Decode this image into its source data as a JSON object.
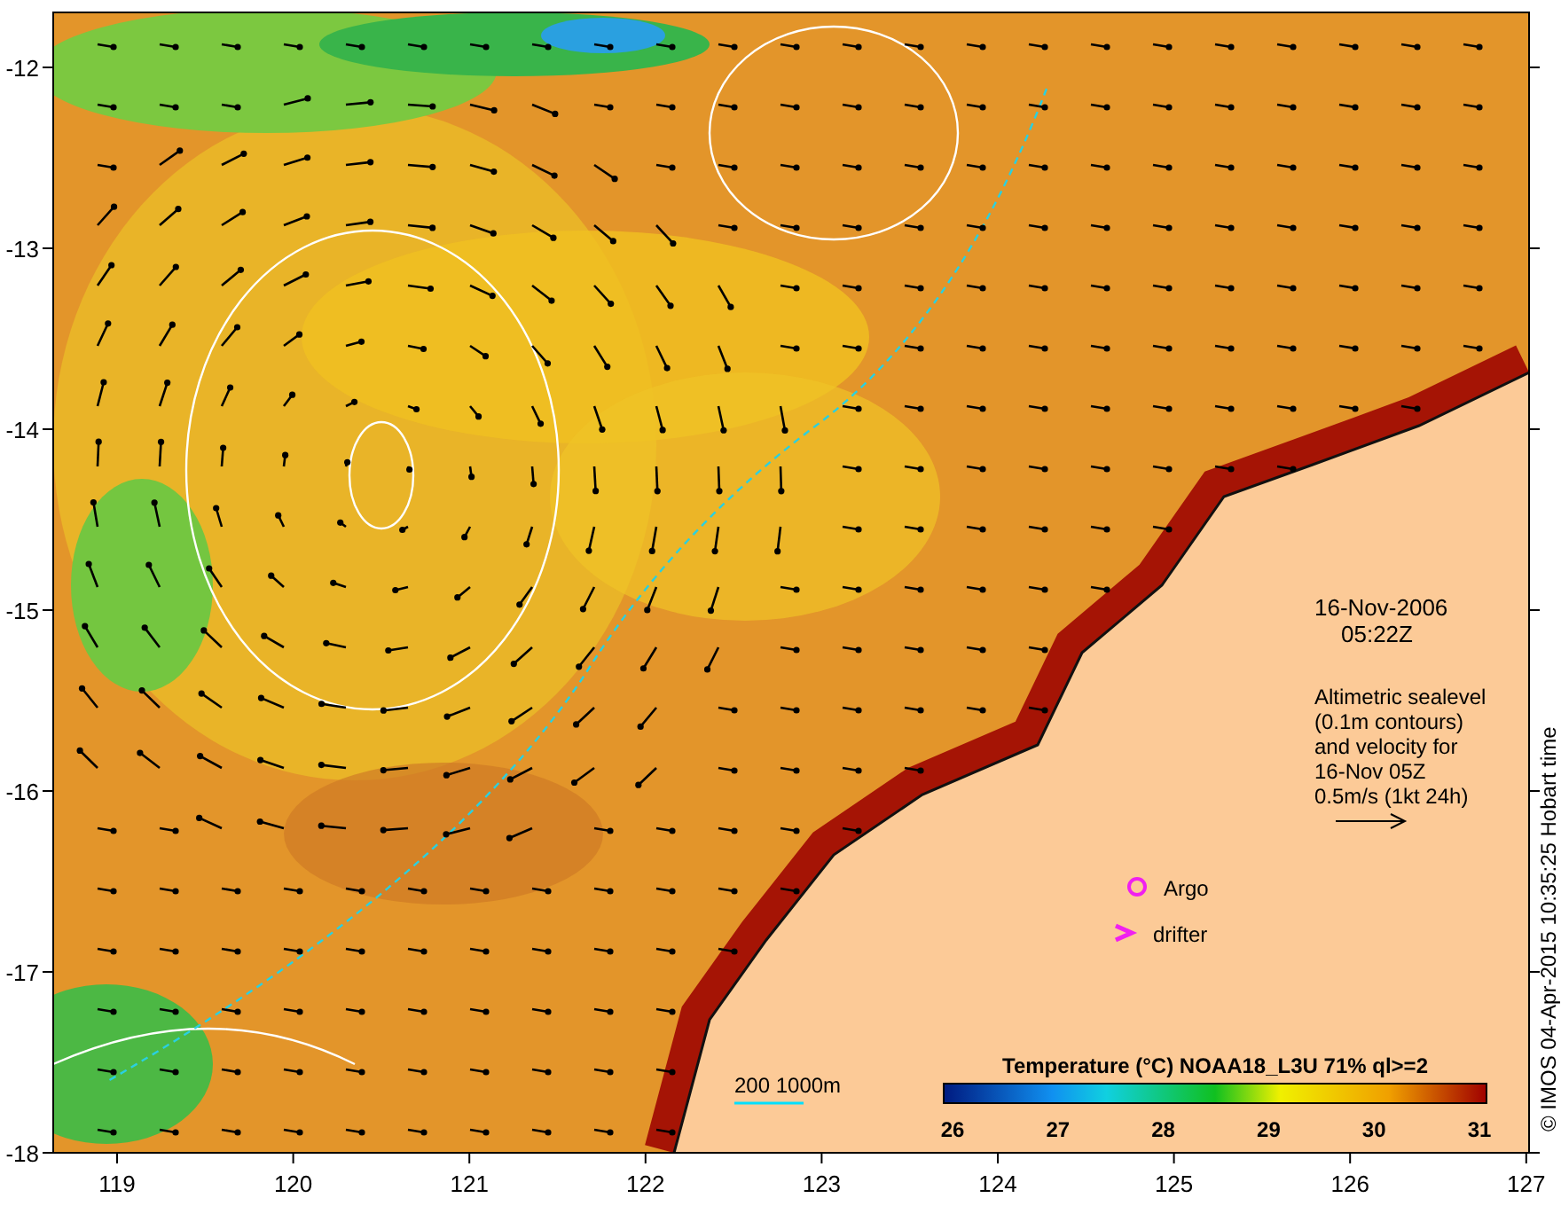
{
  "y_axis": {
    "ticks": [
      "-12",
      "-13",
      "-14",
      "-15",
      "-16",
      "-17",
      "-18"
    ]
  },
  "x_axis": {
    "ticks": [
      "119",
      "120",
      "121",
      "122",
      "123",
      "124",
      "125",
      "126",
      "127"
    ]
  },
  "map": {
    "date": "16-Nov-2006",
    "time": "05:22Z",
    "legend_lines": [
      "Altimetric sealevel",
      "(0.1m contours)",
      "and velocity for",
      "16-Nov 05Z",
      "0.5m/s (1kt 24h)"
    ],
    "argo_label": "Argo",
    "drifter_label": "drifter",
    "scale_label": "200  1000m",
    "colorbar": {
      "title": "Temperature (°C) NOAA18_L3U 71% ql>=2",
      "ticks": [
        "26",
        "27",
        "28",
        "29",
        "30",
        "31"
      ]
    }
  },
  "credit": "© IMOS 04-Apr-2015 10:35:25 Hobart time"
}
